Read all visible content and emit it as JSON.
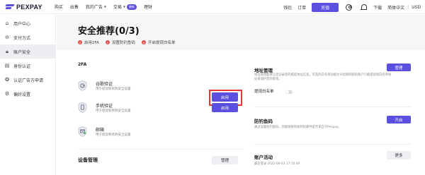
{
  "brand": {
    "name": "PEXPAY"
  },
  "nav": {
    "items": [
      "购买",
      "出售",
      "我的广告",
      "交易",
      "理财"
    ],
    "trade_badge": "最新"
  },
  "topright": {
    "wallet": "钱包",
    "orders": "订单",
    "recharge": "充值",
    "download": "下载",
    "language": "简体中文",
    "currency": "USD"
  },
  "sidebar": {
    "items": [
      {
        "label": "用户中心",
        "icon": "home-icon"
      },
      {
        "label": "支付方式",
        "icon": "wallet-icon"
      },
      {
        "label": "账户安全",
        "icon": "lock-icon",
        "active": true
      },
      {
        "label": "身份认证",
        "icon": "id-card-icon"
      },
      {
        "label": "认证广告方申请",
        "icon": "certified-icon"
      },
      {
        "label": "偏好设置",
        "icon": "gear-icon"
      }
    ]
  },
  "page": {
    "title": "安全推荐(0/3)",
    "checks": [
      "启用2FA",
      "设置防钓鱼码",
      "开启提现白名单"
    ]
  },
  "twofa": {
    "title": "2FA",
    "items": [
      {
        "name": "谷歌验证",
        "desc": "用于提现和修改安全设置",
        "button": "启用"
      },
      {
        "name": "手机验证",
        "desc": "用于提现和修改安全设置",
        "button": "启用"
      },
      {
        "name": "邮箱",
        "desc": "用于提现和修改安全设置"
      }
    ]
  },
  "device": {
    "title": "设备管理",
    "button": "管理"
  },
  "address": {
    "title": "地址管理",
    "desc": "地址管理能够让您记录您的提现地址信息。可选的白名单功能允许您限制您的账户只能提现到白名单地址来保护您的资金。",
    "button": "管理",
    "whitelist_label": "提现白名单"
  },
  "antiphishing": {
    "title": "防钓鱼码",
    "desc": "通过设置防钓鱼码，您能够辨别收到的邮件是否来自于Pexpay。",
    "button": "开启"
  },
  "activity": {
    "title": "账户活动",
    "last_login": "最近登录 2022-09-03 17:10:49",
    "button": "更多"
  },
  "colors": {
    "accent": "#5b4fe0",
    "danger": "#e54d4d"
  }
}
